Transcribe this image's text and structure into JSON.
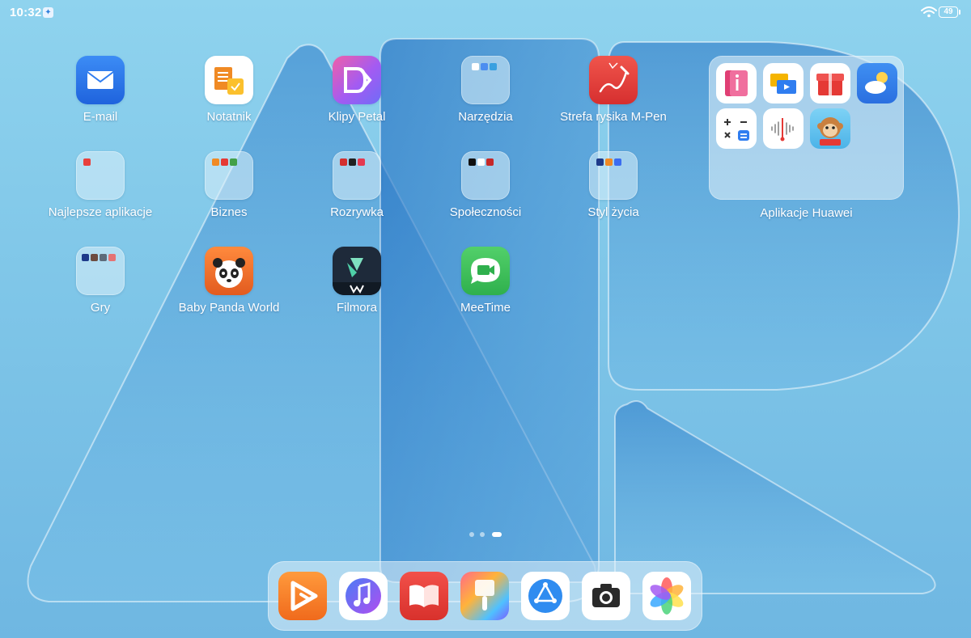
{
  "status_bar": {
    "time": "10:32",
    "battery": "49"
  },
  "grid": {
    "row1": [
      {
        "label": "E-mail",
        "icon": "mail-icon"
      },
      {
        "label": "Notatnik",
        "icon": "notepad-icon"
      },
      {
        "label": "Klipy Petal",
        "icon": "petal-clips-icon"
      },
      {
        "label": "Narzędzia",
        "icon": "tools-folder-icon"
      },
      {
        "label": "Strefa rysika M-Pen",
        "icon": "mpen-icon"
      }
    ],
    "row2": [
      {
        "label": "Najlepsze aplikacje",
        "icon": "best-apps-folder-icon"
      },
      {
        "label": "Biznes",
        "icon": "business-folder-icon"
      },
      {
        "label": "Rozrywka",
        "icon": "entertainment-folder-icon"
      },
      {
        "label": "Społeczności",
        "icon": "social-folder-icon"
      },
      {
        "label": "Styl życia",
        "icon": "lifestyle-folder-icon"
      }
    ],
    "row3": [
      {
        "label": "Gry",
        "icon": "games-folder-icon"
      },
      {
        "label": "Baby Panda World",
        "icon": "panda-icon"
      },
      {
        "label": "Filmora",
        "icon": "filmora-icon"
      },
      {
        "label": "MeeTime",
        "icon": "meetime-icon"
      }
    ]
  },
  "big_folder": {
    "label": "Aplikacje Huawei",
    "apps": [
      "tips-icon",
      "cast-icon",
      "gift-box-icon",
      "weather-icon",
      "calculator-icon",
      "voice-recorder-icon",
      "monkey-kids-icon"
    ]
  },
  "dock": {
    "apps": [
      "video-icon",
      "music-icon",
      "books-icon",
      "themes-icon",
      "browser-icon",
      "camera-icon",
      "gallery-icon"
    ]
  },
  "colors": {
    "mail": "#2f7df0",
    "notes": "#f39a2b",
    "petal": "#c45cf0",
    "mpen": "#e8403c",
    "meetime": "#3ec15a",
    "filmora": "#1e2a3a"
  }
}
